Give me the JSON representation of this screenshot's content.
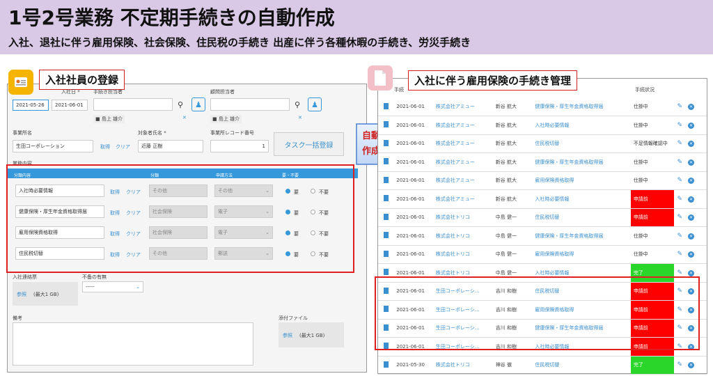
{
  "header": {
    "title": "1号2号業務 不定期手続きの自動作成",
    "subtitle": "入社、退社に伴う雇用保険、社会保険、住民税の手続き 出産に伴う各種休暇の手続き、労災手続き"
  },
  "left": {
    "callout": "入社社員の登録",
    "date_label1": "入社日 *",
    "date_label2": "手続き担当者",
    "date1": "2021-05-26",
    "date2": "2021-06-01",
    "assignee1": "島上 雄介",
    "advisor_label": "顧問担当者",
    "assignee2": "島上 雄介",
    "office_label": "事業所名",
    "office_value": "生田コーポレーション",
    "target_label": "対象者氏名 *",
    "target_value": "近藤 正樹",
    "record_label": "事業所レコード番号",
    "record_value": "1",
    "fetch": "取得",
    "clear": "クリア",
    "bulk_button": "タスク一括登録",
    "section_label": "業務内容",
    "columns": [
      "分類内容",
      "分類",
      "申請方法",
      "要・不要"
    ],
    "rows": [
      {
        "item": "入社時必要情報",
        "cat": "その他",
        "method": "その他"
      },
      {
        "item": "健康保険・厚生年金資格取得届",
        "cat": "社会保険",
        "method": "電子"
      },
      {
        "item": "雇用保険資格取得",
        "cat": "社会保険",
        "method": "電子"
      },
      {
        "item": "住民税切替",
        "cat": "その他",
        "method": "郵送"
      }
    ],
    "need": "要",
    "notneed": "不要",
    "contact_label": "入社連絡票",
    "browse": "参照",
    "maxsize": "(最大1 GB)",
    "shortage_label": "不备の有無",
    "select_placeholder": "-----",
    "notes_label": "備考",
    "attach_label": "添付ファイル"
  },
  "arrow_text": [
    "自動",
    "作成"
  ],
  "right": {
    "callout": "入社に伴う雇用保険の手続き管理",
    "header_task": "手続",
    "header_status": "手続状況",
    "rows": [
      {
        "date": "2021-06-01",
        "company": "株式会社アミュー",
        "name": "新谷 航大",
        "task": "健康保険・厚生年金資格取得届",
        "status": "仕掛中",
        "st": ""
      },
      {
        "date": "2021-06-01",
        "company": "株式会社アミュー",
        "name": "新谷 航大",
        "task": "入社時必要情報",
        "status": "仕掛中",
        "st": ""
      },
      {
        "date": "2021-06-01",
        "company": "株式会社アミュー",
        "name": "新谷 航大",
        "task": "住民税切替",
        "status": "不足情報確認中",
        "st": ""
      },
      {
        "date": "2021-06-01",
        "company": "株式会社アミュー",
        "name": "新谷 航大",
        "task": "健康保険・厚生年金資格取得届",
        "status": "仕掛中",
        "st": ""
      },
      {
        "date": "2021-06-01",
        "company": "株式会社アミュー",
        "name": "新谷 航大",
        "task": "雇用保険資格取得",
        "status": "仕掛中",
        "st": ""
      },
      {
        "date": "2021-06-01",
        "company": "株式会社アミュー",
        "name": "新谷 航大",
        "task": "入社時必要情報",
        "status": "申請前",
        "st": "red"
      },
      {
        "date": "2021-06-01",
        "company": "株式会社トリコ",
        "name": "中島 健一",
        "task": "住民税切替",
        "status": "申請前",
        "st": "red"
      },
      {
        "date": "2021-06-01",
        "company": "株式会社トリコ",
        "name": "中島 健一",
        "task": "健康保険・厚生年金資格取得届",
        "status": "仕掛中",
        "st": ""
      },
      {
        "date": "2021-06-01",
        "company": "株式会社トリコ",
        "name": "中島 健一",
        "task": "雇用保険資格取得",
        "status": "仕掛中",
        "st": ""
      },
      {
        "date": "2021-06-01",
        "company": "株式会社トリコ",
        "name": "中島 健一",
        "task": "入社時必要情報",
        "status": "完了",
        "st": "green"
      },
      {
        "date": "2021-06-01",
        "company": "生田コーポレーシ…",
        "name": "吉川 和樹",
        "task": "住民税切替",
        "status": "申請前",
        "st": "red"
      },
      {
        "date": "2021-06-01",
        "company": "生田コーポレーシ…",
        "name": "吉川 和樹",
        "task": "雇用保険資格取得",
        "status": "申請前",
        "st": "red"
      },
      {
        "date": "2021-06-01",
        "company": "生田コーポレーシ…",
        "name": "吉川 和樹",
        "task": "健康保険・厚生年金資格取得届",
        "status": "申請前",
        "st": "red"
      },
      {
        "date": "2021-06-01",
        "company": "生田コーポレーシ…",
        "name": "吉川 和樹",
        "task": "入社時必要情報",
        "status": "申請前",
        "st": "red"
      },
      {
        "date": "2021-05-30",
        "company": "株式会社トリコ",
        "name": "神谷 徹",
        "task": "住民税切替",
        "status": "完了",
        "st": "green"
      }
    ]
  },
  "colors": {
    "accent": "#3498db",
    "red": "#ff0000",
    "green": "#2bd62b",
    "banner": "#d9c8e6"
  }
}
